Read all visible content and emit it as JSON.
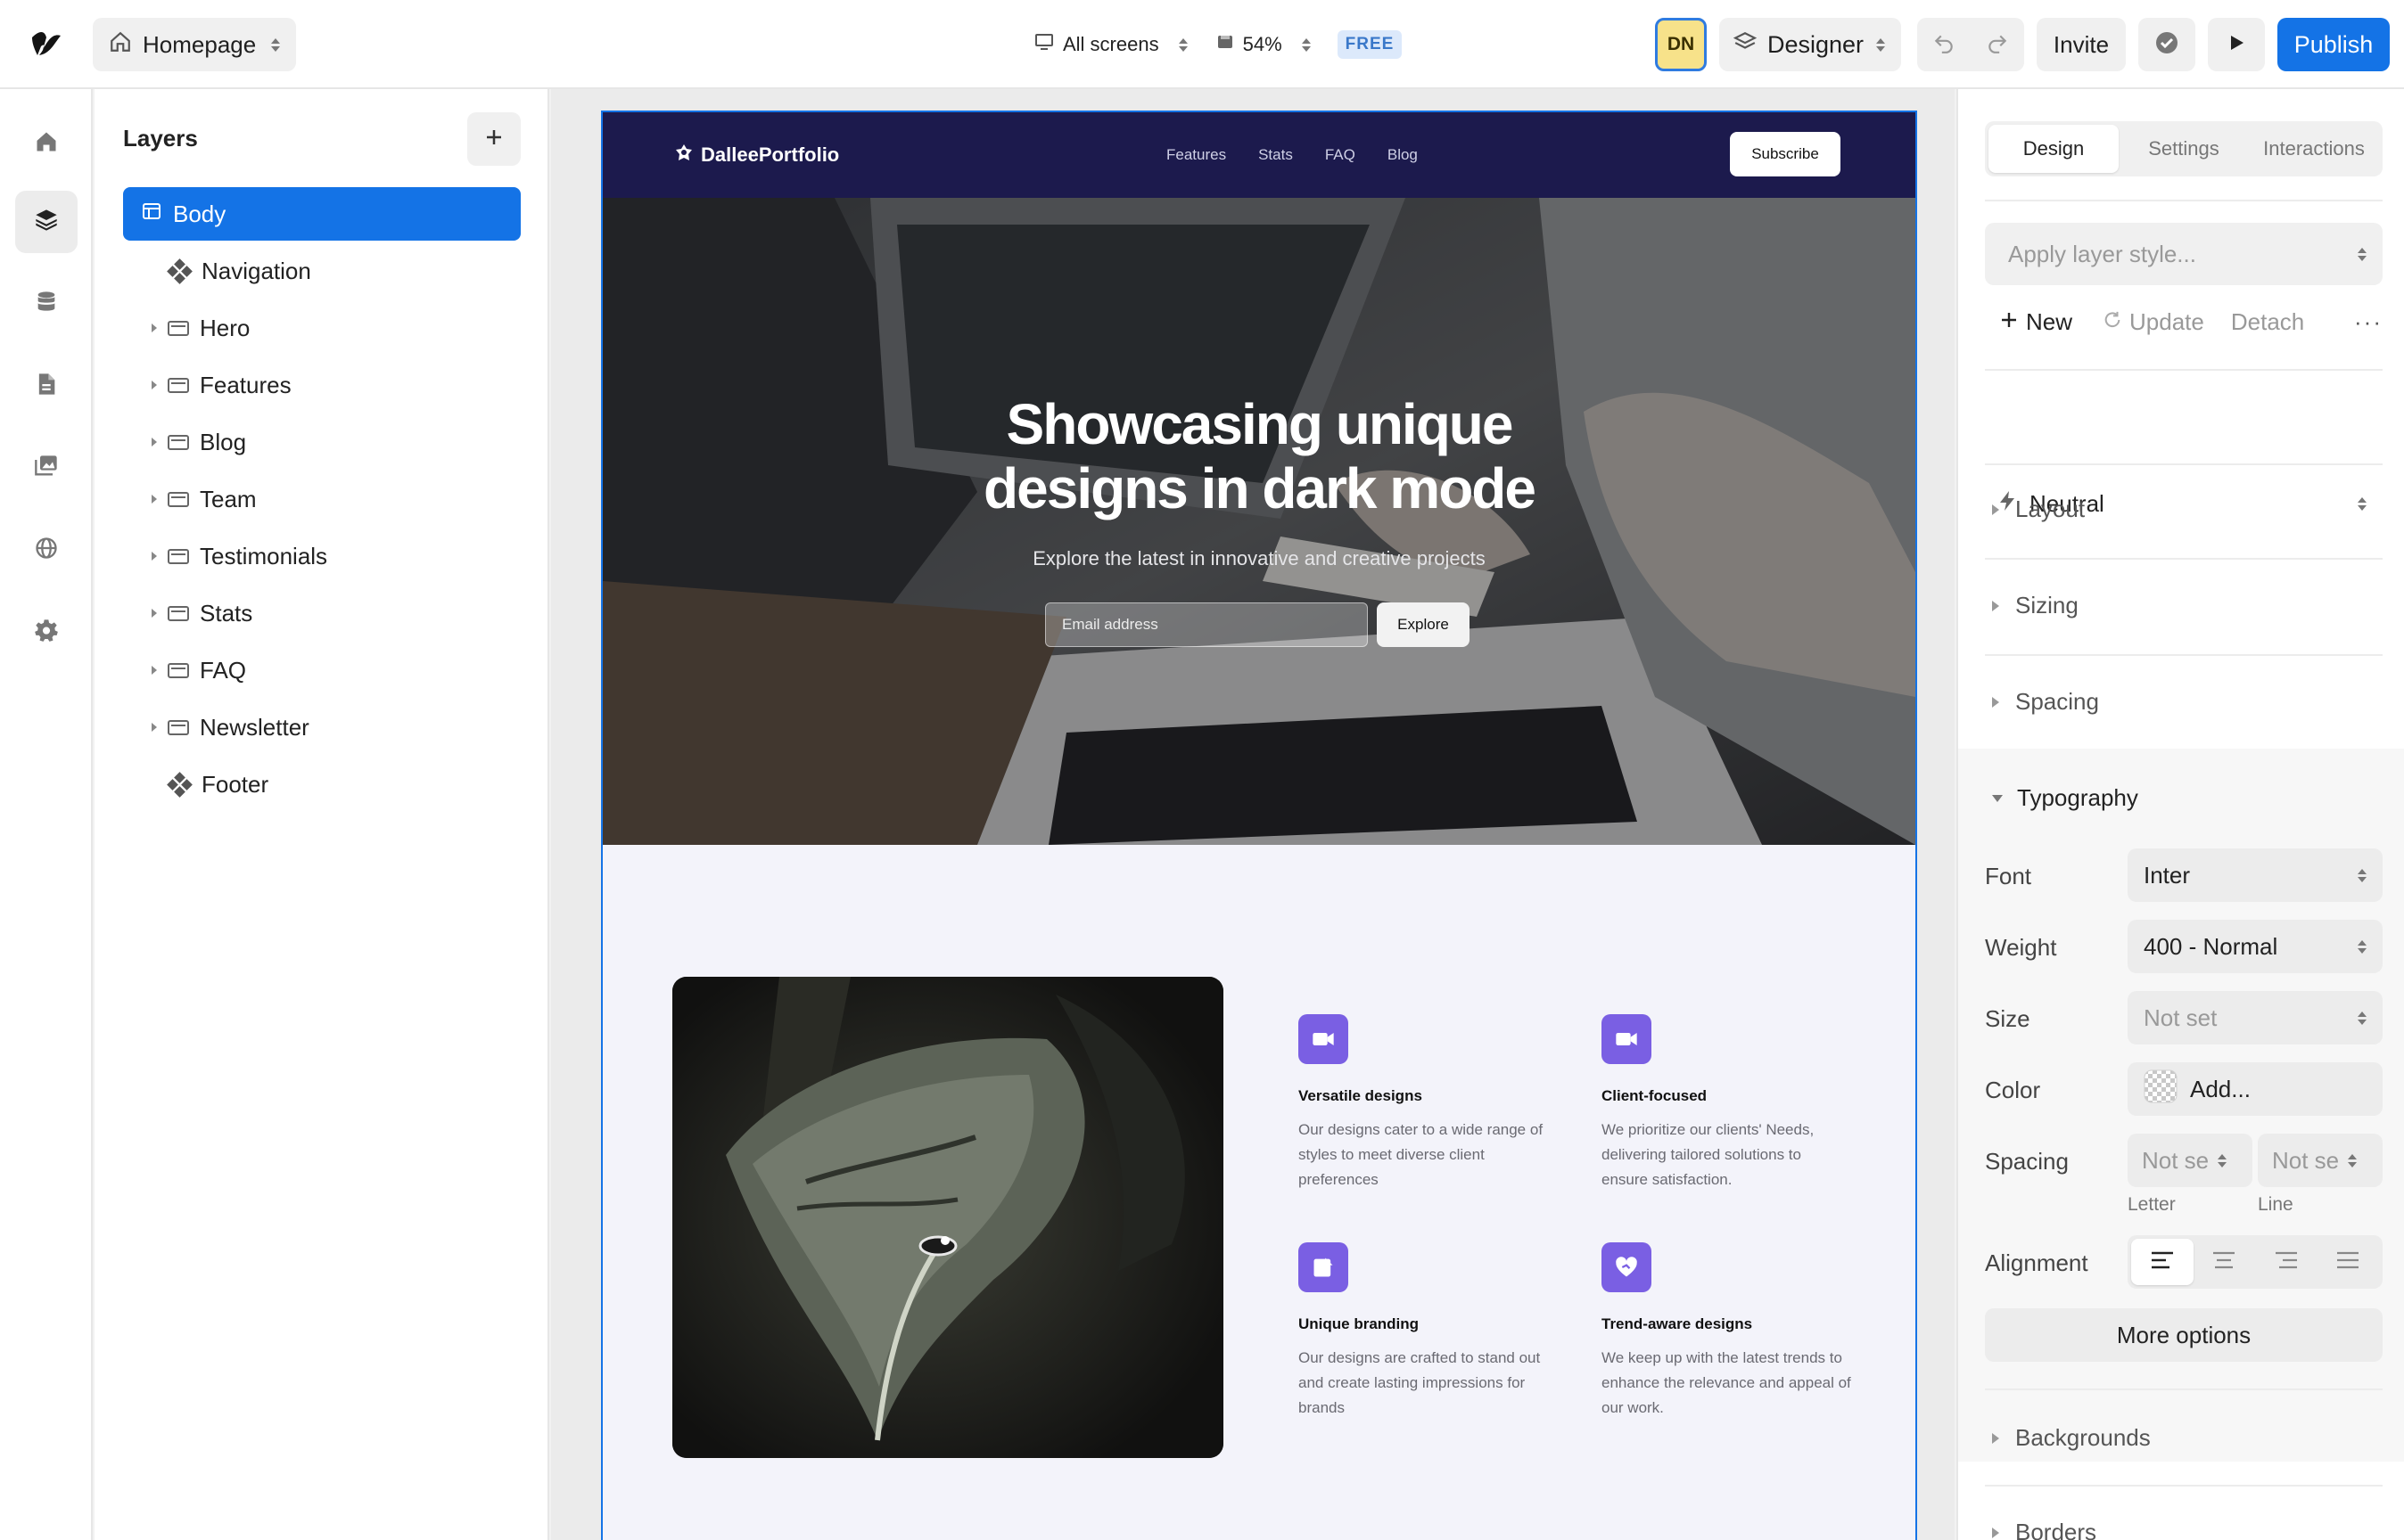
{
  "topbar": {
    "page_name": "Homepage",
    "screens_label": "All screens",
    "zoom": "54%",
    "plan_badge": "FREE",
    "user_initials": "DN",
    "mode": "Designer",
    "invite_label": "Invite",
    "publish_label": "Publish",
    "accent_color": "#1473e6"
  },
  "rail": {
    "icons": [
      "home-icon",
      "layers-icon",
      "database-icon",
      "pages-icon",
      "assets-icon",
      "globe-icon",
      "settings-icon"
    ],
    "active": "layers-icon"
  },
  "layers": {
    "title": "Layers",
    "items": [
      {
        "label": "Body",
        "kind": "frame",
        "expandable": false,
        "selected": true
      },
      {
        "label": "Navigation",
        "kind": "component",
        "expandable": false
      },
      {
        "label": "Hero",
        "kind": "frame",
        "expandable": true
      },
      {
        "label": "Features",
        "kind": "frame",
        "expandable": true
      },
      {
        "label": "Blog",
        "kind": "frame",
        "expandable": true
      },
      {
        "label": "Team",
        "kind": "frame",
        "expandable": true
      },
      {
        "label": "Testimonials",
        "kind": "frame",
        "expandable": true
      },
      {
        "label": "Stats",
        "kind": "frame",
        "expandable": true
      },
      {
        "label": "FAQ",
        "kind": "frame",
        "expandable": true
      },
      {
        "label": "Newsletter",
        "kind": "frame",
        "expandable": true
      },
      {
        "label": "Footer",
        "kind": "component",
        "expandable": false
      }
    ]
  },
  "site": {
    "brand": "DalleePortfolio",
    "nav_links": [
      "Features",
      "Stats",
      "FAQ",
      "Blog"
    ],
    "subscribe_label": "Subscribe",
    "hero": {
      "title_line1": "Showcasing unique",
      "title_line2": "designs in dark mode",
      "subtitle": "Explore the latest in innovative and creative projects",
      "email_placeholder": "Email address",
      "cta_label": "Explore"
    },
    "features": [
      {
        "title": "Versatile designs",
        "desc": "Our designs cater to a wide range of styles to meet diverse client preferences",
        "icon": "video-icon"
      },
      {
        "title": "Client-focused",
        "desc": "We prioritize our clients' Needs, delivering tailored solutions to ensure satisfaction.",
        "icon": "video-icon"
      },
      {
        "title": "Unique branding",
        "desc": "Our designs are crafted to stand out and create lasting impressions for brands",
        "icon": "edit-icon"
      },
      {
        "title": "Trend-aware designs",
        "desc": "We keep up with the latest trends to enhance the relevance and appeal of our work.",
        "icon": "heart-hand-icon"
      }
    ],
    "feature_icon_color": "#7a5fe3",
    "nav_bg": "#1c1a4d"
  },
  "panel": {
    "tabs": [
      "Design",
      "Settings",
      "Interactions"
    ],
    "active_tab": "Design",
    "layer_style_placeholder": "Apply layer style...",
    "actions": {
      "new": "New",
      "update": "Update",
      "detach": "Detach"
    },
    "variant": "Neutral",
    "sections": {
      "layout": "Layout",
      "sizing": "Sizing",
      "spacing": "Spacing",
      "typography": "Typography",
      "backgrounds": "Backgrounds",
      "borders": "Borders"
    },
    "typography": {
      "font_label": "Font",
      "font_value": "Inter",
      "weight_label": "Weight",
      "weight_value": "400 - Normal",
      "size_label": "Size",
      "size_value": "Not set",
      "color_label": "Color",
      "color_value": "Add...",
      "spacing_label": "Spacing",
      "letter_value": "Not se",
      "line_value": "Not se",
      "letter_label": "Letter",
      "line_label": "Line",
      "alignment_label": "Alignment",
      "alignment_active": "left"
    },
    "more_options_label": "More options"
  }
}
